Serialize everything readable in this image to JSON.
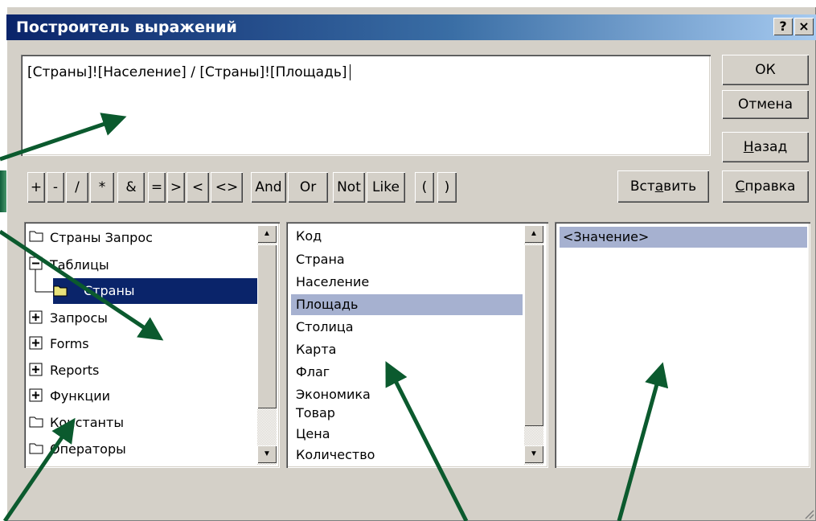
{
  "window": {
    "title": "Построитель выражений",
    "help_button": "?",
    "close_button": "×"
  },
  "expression": {
    "value": "[Страны]![Население] / [Страны]![Площадь]"
  },
  "buttons": {
    "ok": "ОК",
    "cancel": "Отмена",
    "back_pre": "",
    "back_u": "Н",
    "back_post": "азад",
    "insert_pre": "Вст",
    "insert_u": "а",
    "insert_post": "вить",
    "help_pre": "",
    "help_u": "С",
    "help_post": "правка"
  },
  "operators": [
    "+",
    "-",
    "/",
    "*",
    "&",
    "=",
    ">",
    "<",
    "<>",
    "And",
    "Or",
    "Not",
    "Like",
    "(",
    ")"
  ],
  "tree": {
    "items": [
      {
        "label": "Страны Запрос",
        "icon": "folder-icon"
      },
      {
        "label": "Таблицы",
        "icon": "collapse-icon"
      },
      {
        "label": "Страны",
        "icon": "folder-open-icon",
        "selected": true
      },
      {
        "label": "Запросы",
        "icon": "expand-icon"
      },
      {
        "label": "Forms",
        "icon": "expand-icon"
      },
      {
        "label": "Reports",
        "icon": "expand-icon"
      },
      {
        "label": "Функции",
        "icon": "expand-icon"
      },
      {
        "label": "Константы",
        "icon": "folder-icon"
      },
      {
        "label": "Операторы",
        "icon": "folder-icon"
      }
    ]
  },
  "fields": {
    "items": [
      "Код",
      "Страна",
      "Население",
      "Площадь",
      "Столица",
      "Карта",
      "Флаг",
      "Экономика",
      "Товар",
      "Цена",
      "Количество"
    ],
    "selected": "Площадь"
  },
  "values": {
    "items": [
      "<Значение>"
    ],
    "selected": "<Значение>"
  },
  "colors": {
    "selection_dark": "#0a246a",
    "selection_light": "#a6b1d0",
    "arrow": "#0b5a2e",
    "face": "#d4d0c8"
  }
}
